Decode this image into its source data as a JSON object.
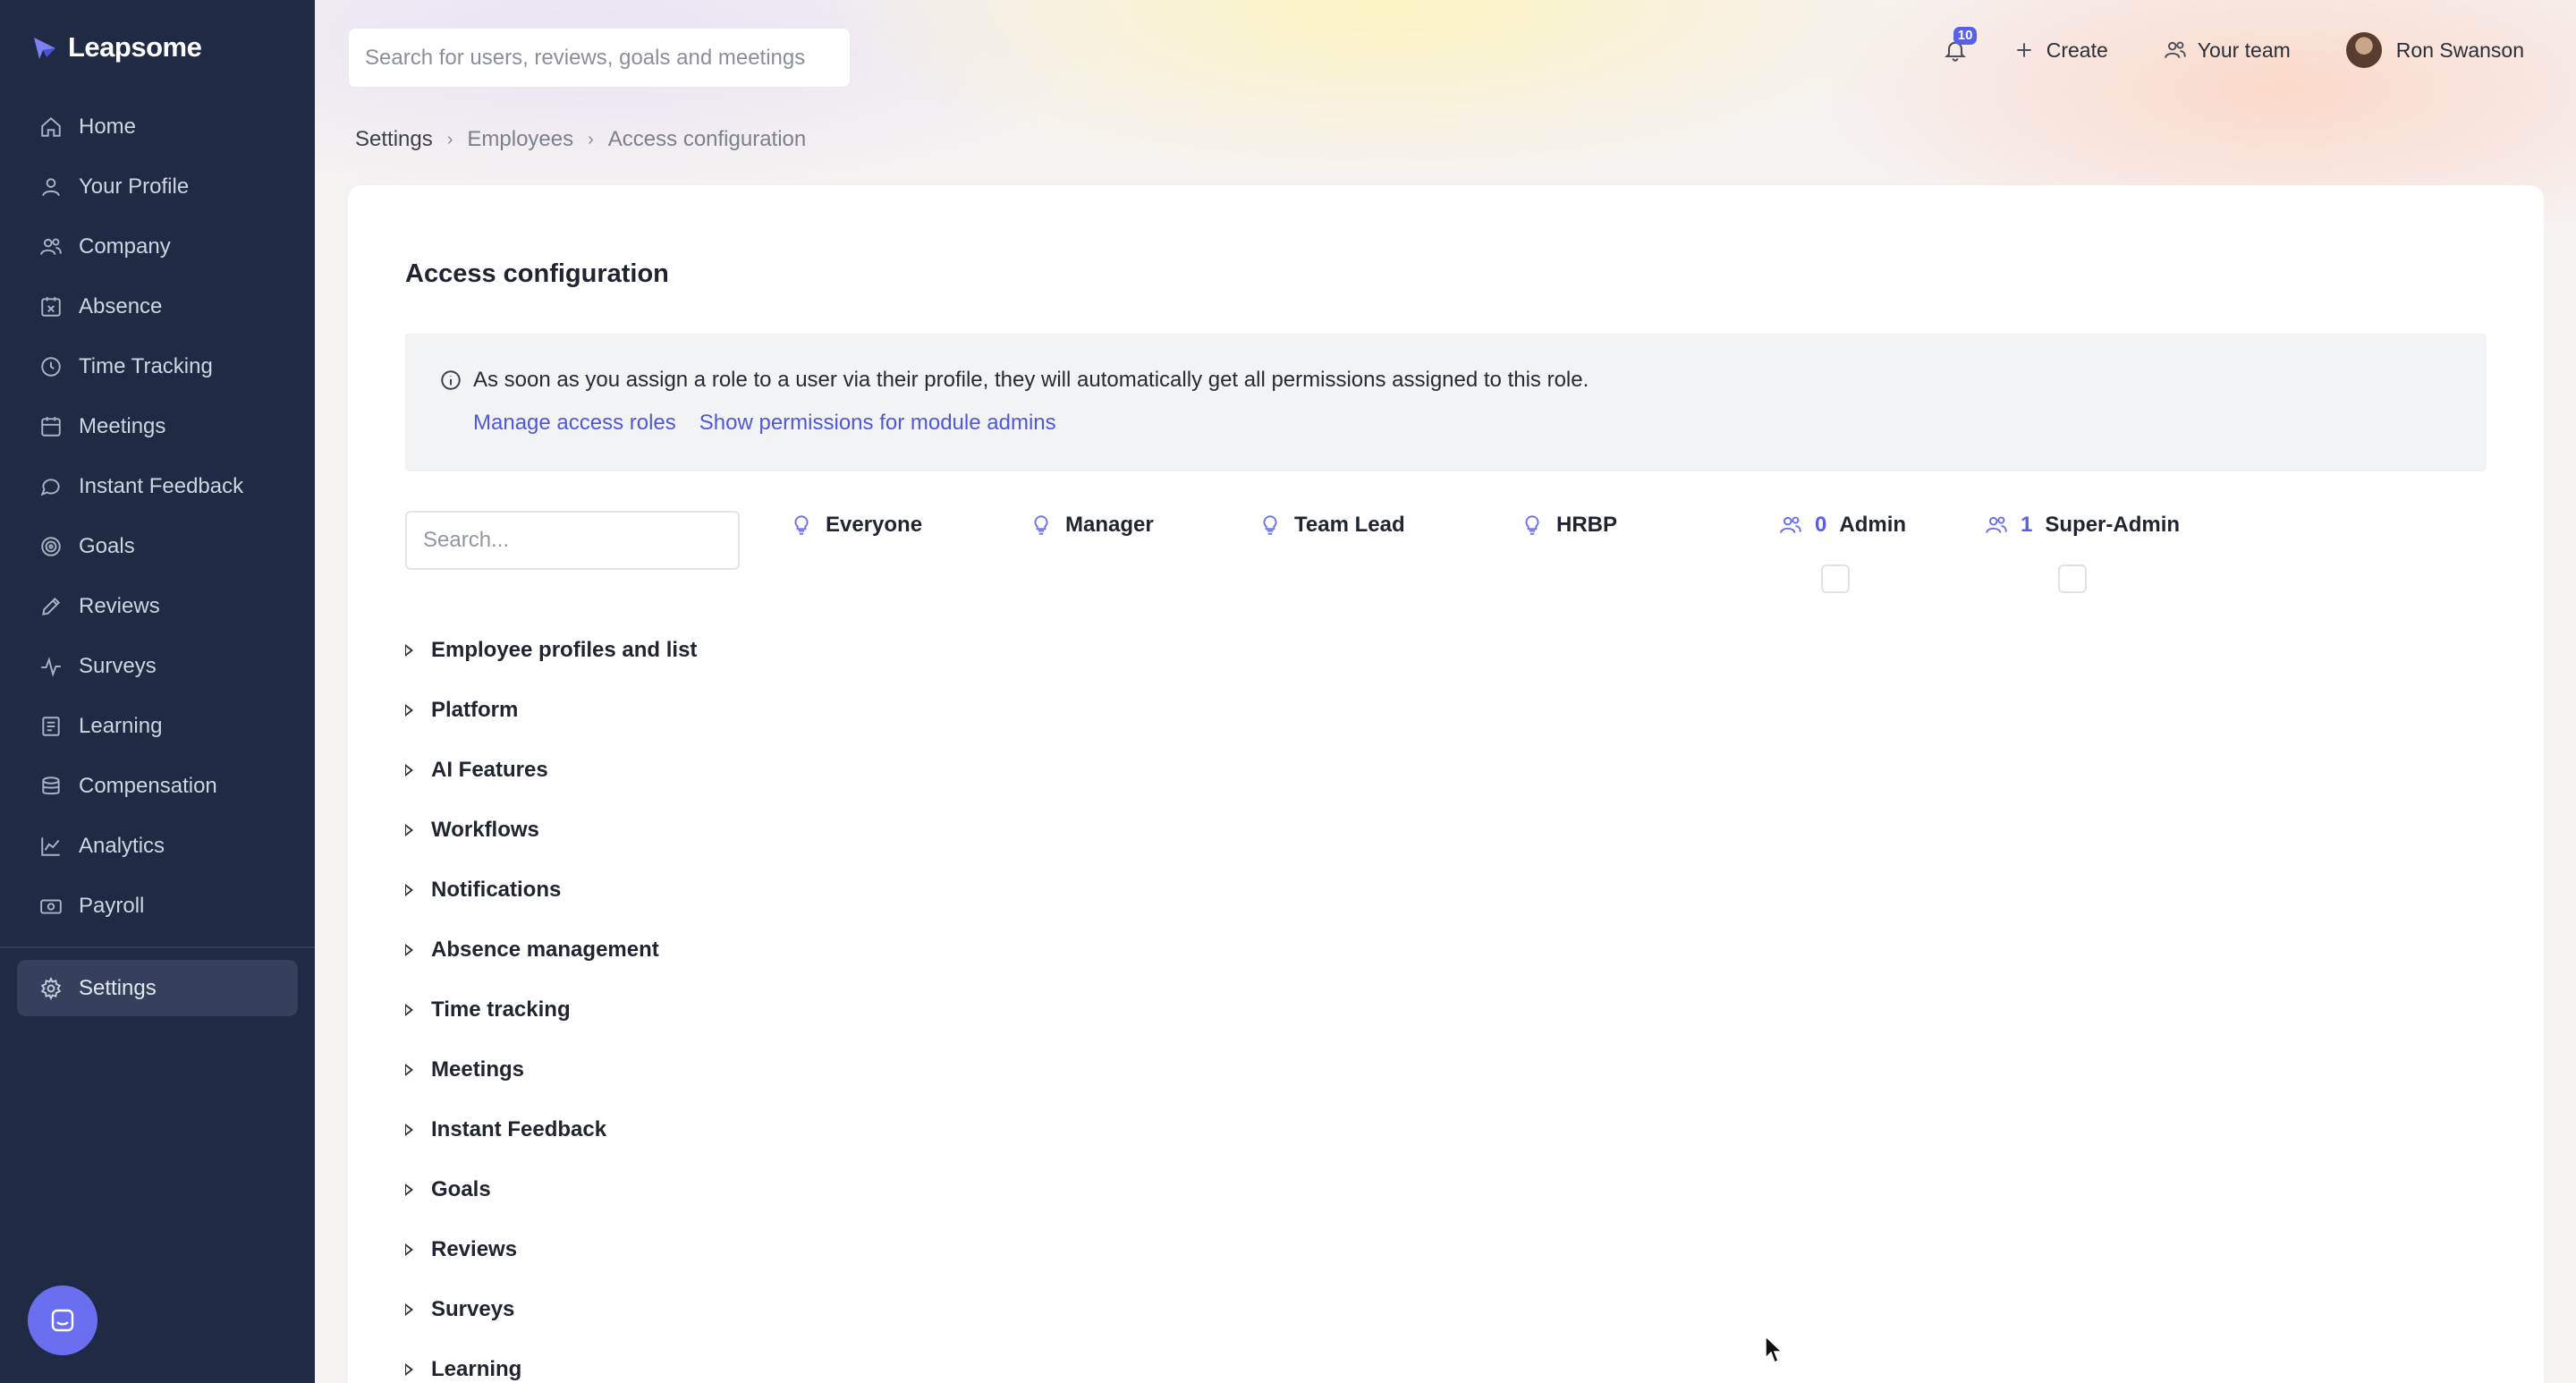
{
  "app": {
    "name": "Leapsome"
  },
  "sidebar": {
    "items": [
      {
        "label": "Home",
        "icon": "home-icon"
      },
      {
        "label": "Your Profile",
        "icon": "user-icon"
      },
      {
        "label": "Company",
        "icon": "users-icon"
      },
      {
        "label": "Absence",
        "icon": "calendar-x-icon"
      },
      {
        "label": "Time Tracking",
        "icon": "clock-icon"
      },
      {
        "label": "Meetings",
        "icon": "calendar-icon"
      },
      {
        "label": "Instant Feedback",
        "icon": "chat-icon"
      },
      {
        "label": "Goals",
        "icon": "target-icon"
      },
      {
        "label": "Reviews",
        "icon": "pencil-icon"
      },
      {
        "label": "Surveys",
        "icon": "pulse-icon"
      },
      {
        "label": "Learning",
        "icon": "book-icon"
      },
      {
        "label": "Compensation",
        "icon": "coins-icon"
      },
      {
        "label": "Analytics",
        "icon": "chart-icon"
      },
      {
        "label": "Payroll",
        "icon": "money-icon"
      }
    ],
    "settings_label": "Settings"
  },
  "header": {
    "search_placeholder": "Search for users, reviews, goals and meetings",
    "notification_count": "10",
    "create_label": "Create",
    "team_label": "Your team",
    "user_name": "Ron Swanson"
  },
  "breadcrumb": [
    "Settings",
    "Employees",
    "Access configuration"
  ],
  "page": {
    "title": "Access configuration",
    "info_text": "As soon as you assign a role to a user via their profile, they will automatically get all permissions assigned to this role.",
    "link_manage": "Manage access roles",
    "link_show": "Show permissions for module admins",
    "search_placeholder": "Search..."
  },
  "roles": [
    {
      "label": "Everyone",
      "icon": "bulb-icon",
      "count": ""
    },
    {
      "label": "Manager",
      "icon": "bulb-icon",
      "count": ""
    },
    {
      "label": "Team Lead",
      "icon": "bulb-icon",
      "count": ""
    },
    {
      "label": "HRBP",
      "icon": "bulb-icon",
      "count": ""
    },
    {
      "label": "Admin",
      "icon": "users-icon",
      "count": "0"
    },
    {
      "label": "Super-Admin",
      "icon": "users-icon",
      "count": "1"
    }
  ],
  "sections": [
    "Employee profiles and list",
    "Platform",
    "AI Features",
    "Workflows",
    "Notifications",
    "Absence management",
    "Time tracking",
    "Meetings",
    "Instant Feedback",
    "Goals",
    "Reviews",
    "Surveys",
    "Learning"
  ],
  "colors": {
    "sidebar": "#1f2a44",
    "accent": "#5960e6"
  }
}
